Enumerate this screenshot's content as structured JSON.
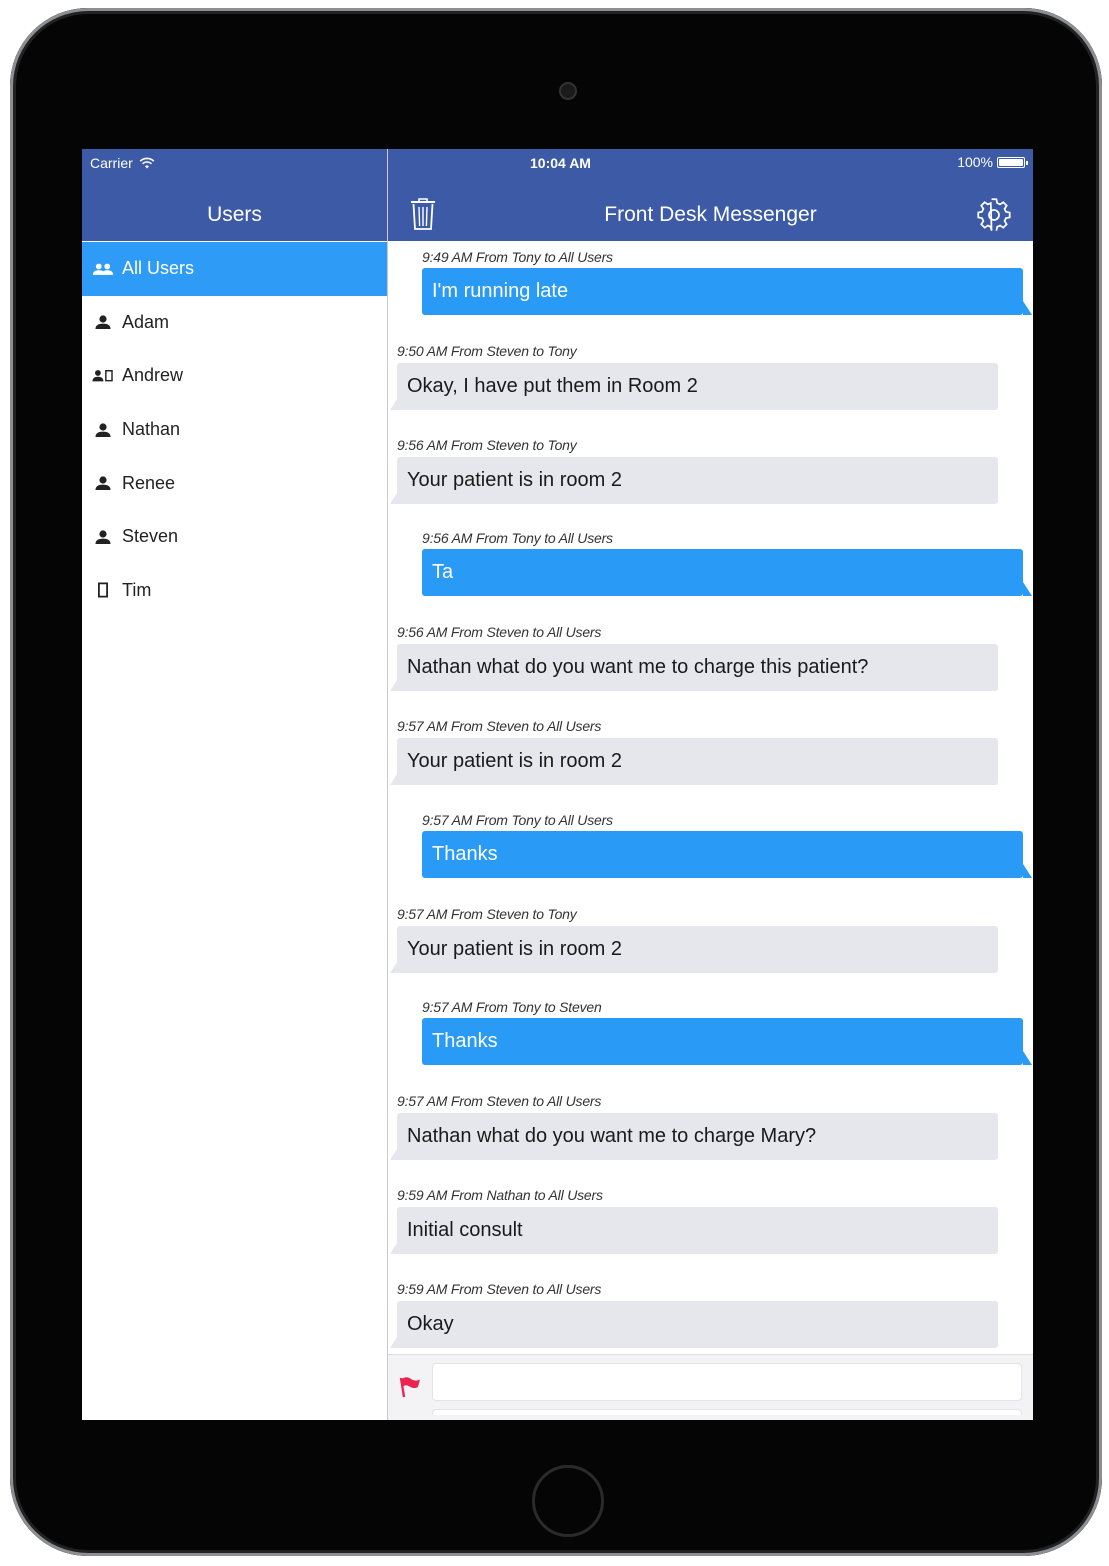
{
  "status_bar": {
    "carrier": "Carrier",
    "time": "10:04 AM",
    "battery": "100%"
  },
  "sidebar": {
    "title": "Users",
    "items": [
      {
        "label": "All Users",
        "icon": "group-icon",
        "active": true
      },
      {
        "label": "Adam",
        "icon": "person-icon",
        "active": false
      },
      {
        "label": "Andrew",
        "icon": "person-tablet-icon",
        "active": false
      },
      {
        "label": "Nathan",
        "icon": "person-icon",
        "active": false
      },
      {
        "label": "Renee",
        "icon": "person-icon",
        "active": false
      },
      {
        "label": "Steven",
        "icon": "person-icon",
        "active": false
      },
      {
        "label": "Tim",
        "icon": "tablet-icon",
        "active": false
      }
    ]
  },
  "main": {
    "title": "Front Desk Messenger",
    "messages": [
      {
        "meta": "9:49 AM From Tony to All Users",
        "text": "I'm running late",
        "outgoing": true
      },
      {
        "meta": "9:50 AM From Steven to Tony",
        "text": "Okay, I have put them in Room 2",
        "outgoing": false
      },
      {
        "meta": "9:56 AM From Steven to Tony",
        "text": "Your patient is in room 2",
        "outgoing": false
      },
      {
        "meta": "9:56 AM From Tony to All Users",
        "text": "Ta",
        "outgoing": true
      },
      {
        "meta": "9:56 AM From Steven to All Users",
        "text": "Nathan what do you want me to charge this patient?",
        "outgoing": false
      },
      {
        "meta": "9:57 AM From Steven to All Users",
        "text": "Your patient is in room 2",
        "outgoing": false
      },
      {
        "meta": "9:57 AM From Tony to All Users",
        "text": "Thanks",
        "outgoing": true
      },
      {
        "meta": "9:57 AM From Steven to Tony",
        "text": "Your patient is in room 2",
        "outgoing": false
      },
      {
        "meta": "9:57 AM From Tony to Steven",
        "text": "Thanks",
        "outgoing": true
      },
      {
        "meta": "9:57 AM From Steven to All Users",
        "text": "Nathan what do you want me to charge Mary?",
        "outgoing": false
      },
      {
        "meta": "9:59 AM From Nathan to All Users",
        "text": "Initial consult",
        "outgoing": false
      },
      {
        "meta": "9:59 AM From Steven to All Users",
        "text": "Okay",
        "outgoing": false
      }
    ],
    "compose": {
      "value": "",
      "placeholder": ""
    }
  },
  "colors": {
    "header": "#3c5aa6",
    "accent": "#2e9bf7",
    "incoming_bubble": "#e6e6ed",
    "flag": "#e8264f"
  },
  "icons": {
    "trash": "trash-icon",
    "settings": "gear-icon",
    "flag": "flag-icon",
    "wifi": "wifi-icon",
    "battery": "battery-icon"
  }
}
